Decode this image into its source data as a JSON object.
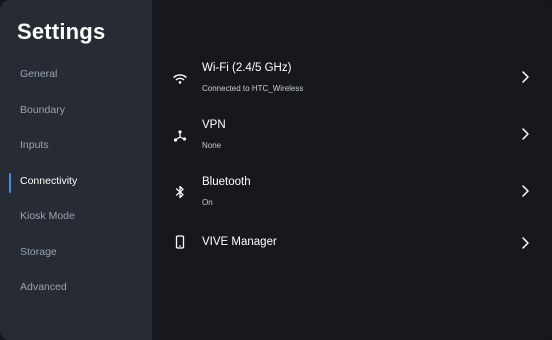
{
  "sidebar": {
    "title": "Settings",
    "items": [
      {
        "label": "General",
        "active": false
      },
      {
        "label": "Boundary",
        "active": false
      },
      {
        "label": "Inputs",
        "active": false
      },
      {
        "label": "Connectivity",
        "active": true
      },
      {
        "label": "Kiosk Mode",
        "active": false
      },
      {
        "label": "Storage",
        "active": false
      },
      {
        "label": "Advanced",
        "active": false
      }
    ],
    "accent_color": "#3e8df2"
  },
  "main": {
    "rows": [
      {
        "icon": "wifi-icon",
        "title": "Wi-Fi (2.4/5 GHz)",
        "subtitle": "Connected to HTC_Wireless"
      },
      {
        "icon": "vpn-icon",
        "title": "VPN",
        "subtitle": "None"
      },
      {
        "icon": "bluetooth-icon",
        "title": "Bluetooth",
        "subtitle": "On"
      },
      {
        "icon": "phone-icon",
        "title": "VIVE Manager",
        "subtitle": ""
      }
    ]
  }
}
